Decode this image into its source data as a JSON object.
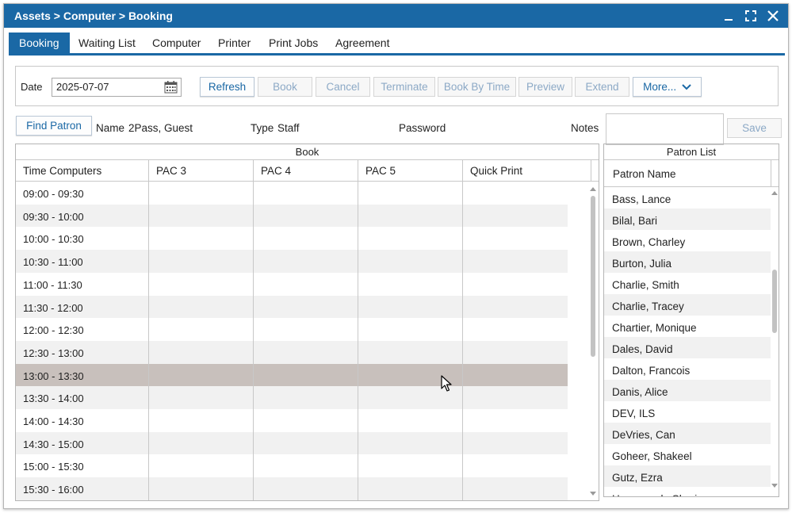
{
  "window": {
    "title": "Assets > Computer > Booking"
  },
  "tabs": [
    {
      "label": "Booking",
      "active": true
    },
    {
      "label": "Waiting List",
      "active": false
    },
    {
      "label": "Computer",
      "active": false
    },
    {
      "label": "Printer",
      "active": false
    },
    {
      "label": "Print Jobs",
      "active": false
    },
    {
      "label": "Agreement",
      "active": false
    }
  ],
  "toolbar": {
    "date_label": "Date",
    "date_value": "2025-07-07",
    "buttons": {
      "refresh": "Refresh",
      "book": "Book",
      "cancel": "Cancel",
      "terminate": "Terminate",
      "book_by_time": "Book By Time",
      "preview": "Preview",
      "extend": "Extend",
      "more": "More..."
    }
  },
  "patron": {
    "find_label": "Find Patron",
    "name_label": "Name",
    "name_value": "2Pass, Guest",
    "type_label": "Type",
    "type_value": "Staff",
    "password_label": "Password",
    "notes_label": "Notes",
    "save_label": "Save"
  },
  "book": {
    "title": "Book",
    "columns": [
      "Time Computers",
      "PAC 3",
      "PAC 4",
      "PAC 5",
      "Quick Print"
    ],
    "time_slots": [
      "09:00 - 09:30",
      "09:30 - 10:00",
      "10:00 - 10:30",
      "10:30 - 11:00",
      "11:00 - 11:30",
      "11:30 - 12:00",
      "12:00 - 12:30",
      "12:30 - 13:00",
      "13:00 - 13:30",
      "13:30 - 14:00",
      "14:00 - 14:30",
      "14:30 - 15:00",
      "15:00 - 15:30",
      "15:30 - 16:00"
    ],
    "selected_slot": "13:00 - 13:30"
  },
  "patron_list": {
    "title": "Patron List",
    "column": "Patron Name",
    "names": [
      "Bass, Lance",
      "Bilal, Bari",
      "Brown, Charley",
      "Burton, Julia",
      "Charlie, Smith",
      "Charlie, Tracey",
      "Chartier, Monique",
      "Dales, David",
      "Dalton, Francois",
      "Danis, Alice",
      "DEV, ILS",
      "DeVries, Can",
      "Goheer, Shakeel",
      "Gutz, Ezra",
      "Herasymuk, Sheri"
    ]
  },
  "colors": {
    "brand": "#1a68a5",
    "selected_row": "#c8c0bc",
    "alt_row": "#f1f1f1"
  }
}
